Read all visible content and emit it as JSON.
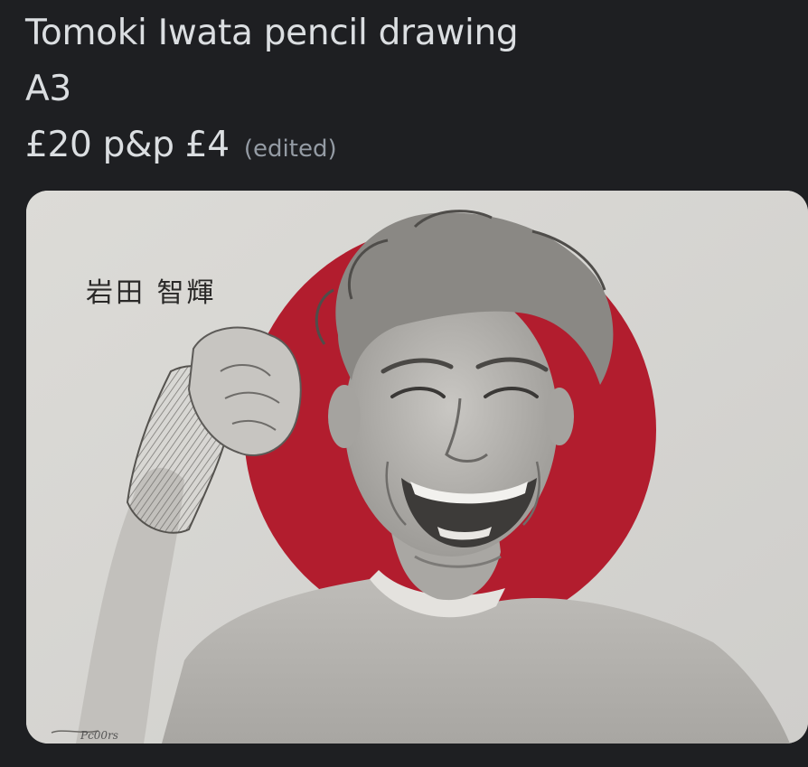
{
  "message": {
    "line1": "Tomoki Iwata pencil drawing",
    "line2": "A3",
    "line3": "£20 p&p £4",
    "edited_label": "(edited)"
  },
  "attachment": {
    "kanji_label": "岩田 智輝",
    "signature": "Pc00rs",
    "alt": "Pencil portrait drawing of a smiling man in front of a red circle"
  },
  "colors": {
    "background": "#1e1f22",
    "text": "#dbdee1",
    "muted": "#949ba4",
    "paper": "#d9d8d4",
    "red_circle": "#b21d2e"
  }
}
